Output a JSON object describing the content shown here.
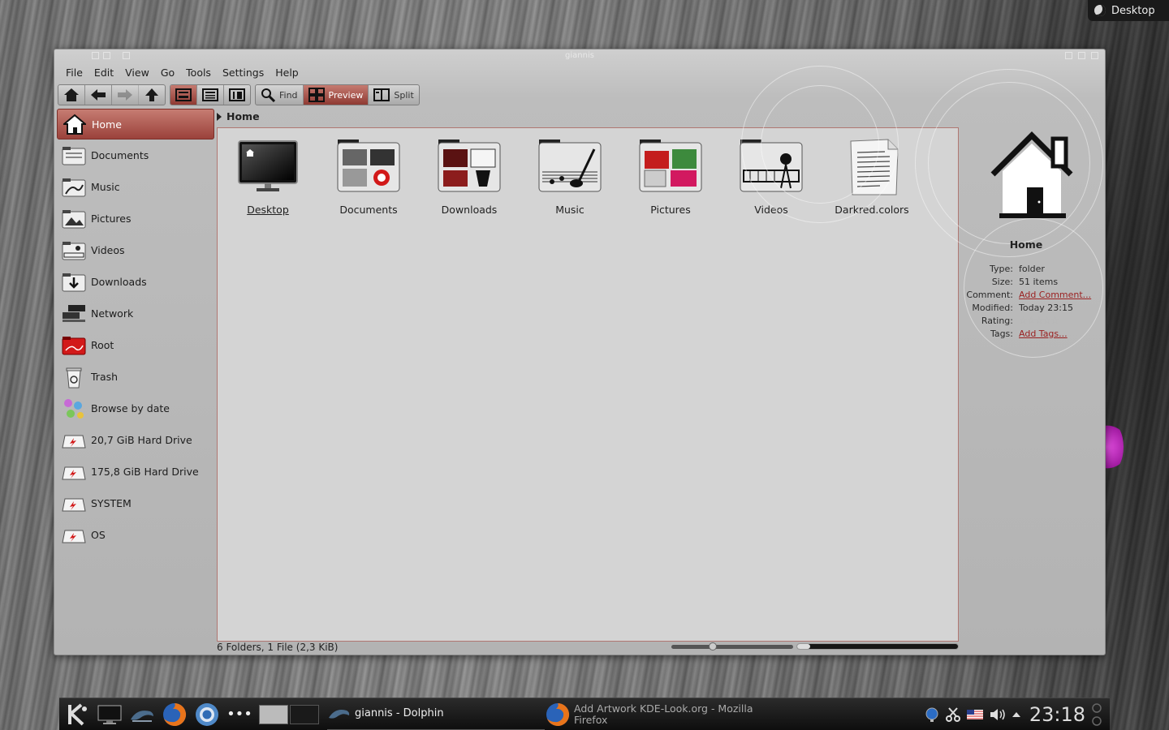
{
  "desktop": {
    "activity_label": "Desktop"
  },
  "window": {
    "title": "giannis"
  },
  "menu": [
    "File",
    "Edit",
    "View",
    "Go",
    "Tools",
    "Settings",
    "Help"
  ],
  "toolbar": {
    "find_label": "Find",
    "preview_label": "Preview",
    "split_label": "Split"
  },
  "places": [
    {
      "label": "Home",
      "icon": "home-icon",
      "selected": true
    },
    {
      "label": "Documents",
      "icon": "folder-documents-icon"
    },
    {
      "label": "Music",
      "icon": "folder-music-icon"
    },
    {
      "label": "Pictures",
      "icon": "folder-pictures-icon"
    },
    {
      "label": "Videos",
      "icon": "folder-videos-icon"
    },
    {
      "label": "Downloads",
      "icon": "folder-downloads-icon"
    },
    {
      "label": "Network",
      "icon": "network-icon"
    },
    {
      "label": "Root",
      "icon": "folder-root-icon"
    },
    {
      "label": "Trash",
      "icon": "trash-icon"
    },
    {
      "label": "Browse by date",
      "icon": "calendar-browse-icon"
    },
    {
      "label": "20,7 GiB Hard Drive",
      "icon": "hard-drive-icon"
    },
    {
      "label": "175,8 GiB Hard Drive",
      "icon": "hard-drive-icon"
    },
    {
      "label": "SYSTEM",
      "icon": "hard-drive-icon"
    },
    {
      "label": "OS",
      "icon": "hard-drive-icon"
    }
  ],
  "location": {
    "crumb": "Home"
  },
  "files": [
    {
      "label": "Desktop",
      "icon": "desktop-folder-icon",
      "hover": true
    },
    {
      "label": "Documents",
      "icon": "documents-folder-icon"
    },
    {
      "label": "Downloads",
      "icon": "downloads-folder-icon"
    },
    {
      "label": "Music",
      "icon": "music-folder-icon"
    },
    {
      "label": "Pictures",
      "icon": "pictures-folder-icon"
    },
    {
      "label": "Videos",
      "icon": "videos-folder-icon"
    },
    {
      "label": "Darkred.colors",
      "icon": "text-file-icon"
    }
  ],
  "status": {
    "text": "6 Folders, 1 File (2,3 KiB)",
    "zoom_fraction": 0.33,
    "disk_fraction": 0.08
  },
  "info": {
    "name": "Home",
    "type_label": "Type:",
    "type_value": "folder",
    "size_label": "Size:",
    "size_value": "51 items",
    "comment_label": "Comment:",
    "comment_value": "Add Comment...",
    "modified_label": "Modified:",
    "modified_value": "Today 23:15",
    "rating_label": "Rating:",
    "rating_value": "☆☆☆☆☆",
    "tags_label": "Tags:",
    "tags_value": "Add Tags..."
  },
  "taskbar": {
    "tasks": [
      {
        "label": "giannis - Dolphin",
        "icon": "dolphin-icon"
      },
      {
        "label_line1": "Add  Artwork KDE-Look.org - Mozilla",
        "label_line2": "Firefox",
        "icon": "firefox-icon"
      }
    ],
    "clock": "23:18",
    "more_label": "•••"
  },
  "colors": {
    "accent": "#9b423b",
    "panel": "#111111",
    "view_bg": "#d4d4d4"
  }
}
